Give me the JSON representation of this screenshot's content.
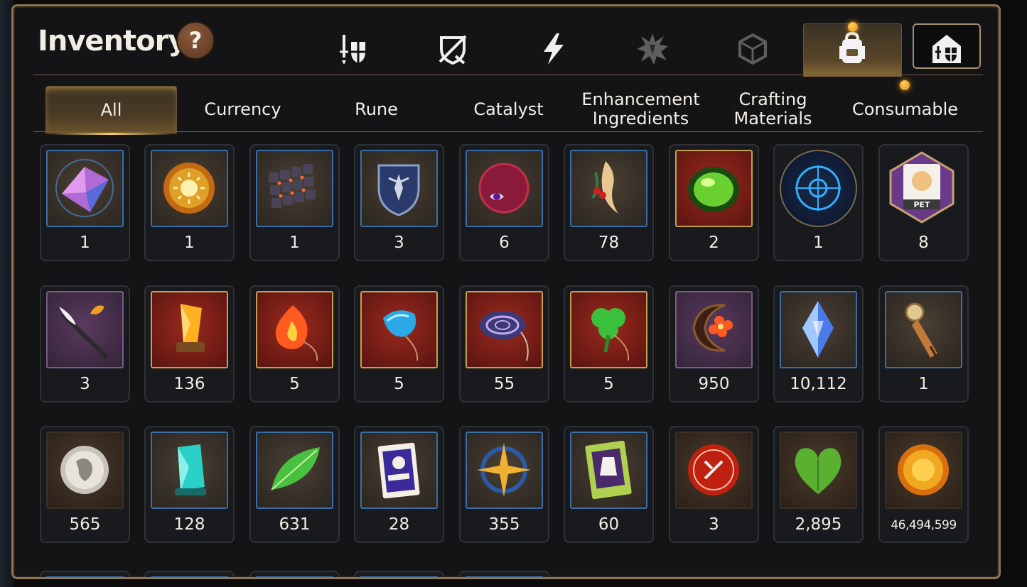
{
  "header": {
    "title": "Inventory",
    "help_label": "?"
  },
  "top_tabs": [
    {
      "icon": "sword-shield-icon"
    },
    {
      "icon": "broken-shield-icon"
    },
    {
      "icon": "lightning-icon"
    },
    {
      "icon": "splat-rune-icon"
    },
    {
      "icon": "cube-icon"
    },
    {
      "icon": "backpack-icon",
      "selected": true
    },
    {
      "icon": "guild-house-icon"
    }
  ],
  "category_tabs": [
    {
      "label": "All",
      "selected": true
    },
    {
      "label": "Currency"
    },
    {
      "label": "Rune"
    },
    {
      "label": "Catalyst"
    },
    {
      "label": "Enhancement\nIngredients"
    },
    {
      "label": "Crafting\nMaterials"
    },
    {
      "label": "Consumable"
    }
  ],
  "items": [
    {
      "name": "crystal-gem-icon",
      "count": "1"
    },
    {
      "name": "sun-coin-icon",
      "count": "1"
    },
    {
      "name": "rune-stones-icon",
      "count": "1"
    },
    {
      "name": "dark-shield-icon",
      "count": "3"
    },
    {
      "name": "eye-orb-icon",
      "count": "6"
    },
    {
      "name": "root-herb-icon",
      "count": "78"
    },
    {
      "name": "green-potion-icon",
      "count": "2"
    },
    {
      "name": "arcane-portal-icon",
      "count": "1"
    },
    {
      "name": "pet-food-bag-icon",
      "count": "8"
    },
    {
      "name": "feather-staff-icon",
      "count": "3"
    },
    {
      "name": "amber-crystal-icon",
      "count": "136"
    },
    {
      "name": "fire-pendant-icon",
      "count": "5"
    },
    {
      "name": "water-pendant-icon",
      "count": "5"
    },
    {
      "name": "swirl-pendant-icon",
      "count": "55"
    },
    {
      "name": "clover-pendant-icon",
      "count": "5"
    },
    {
      "name": "moon-charm-icon",
      "count": "950"
    },
    {
      "name": "blue-shard-icon",
      "count": "10,112"
    },
    {
      "name": "bookmark-icon",
      "count": "1"
    },
    {
      "name": "silver-coin-icon",
      "count": "565"
    },
    {
      "name": "cyan-crystal-icon",
      "count": "128"
    },
    {
      "name": "green-leaf-icon",
      "count": "631"
    },
    {
      "name": "pet-card-icon",
      "count": "28"
    },
    {
      "name": "star-compass-icon",
      "count": "355"
    },
    {
      "name": "costume-card-icon",
      "count": "60"
    },
    {
      "name": "red-badge-icon",
      "count": "3"
    },
    {
      "name": "green-heart-icon",
      "count": "2,895"
    },
    {
      "name": "gold-coin-icon",
      "count": "46,494,599"
    }
  ]
}
